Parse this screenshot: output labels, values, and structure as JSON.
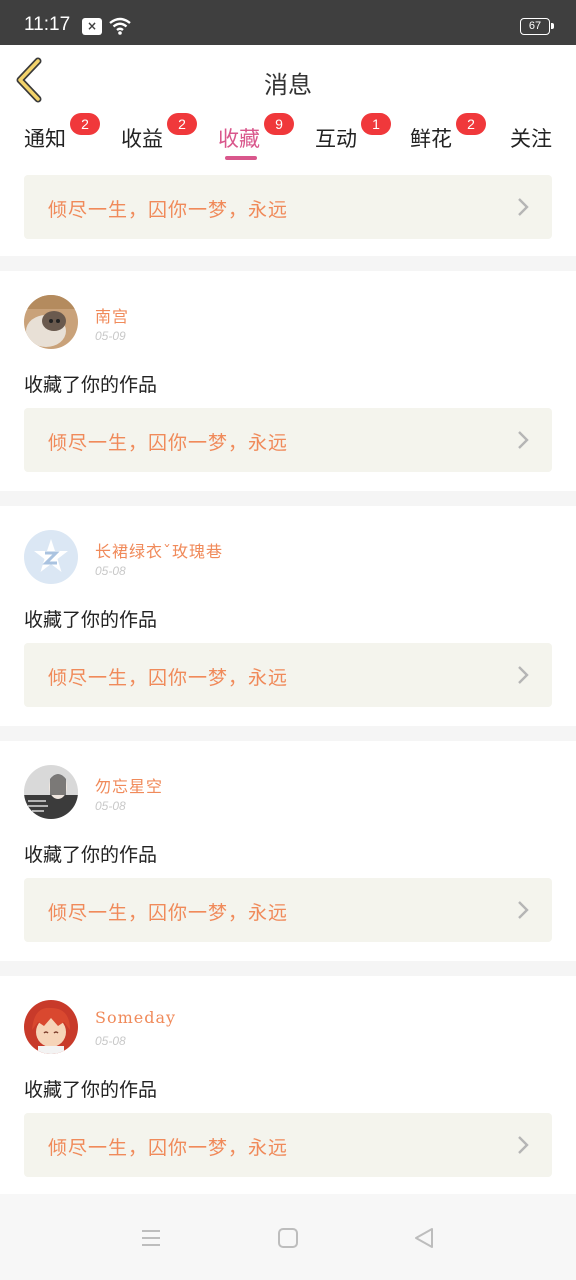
{
  "status_bar": {
    "time": "11:17",
    "battery": "67",
    "icons": [
      "close-notification-icon",
      "wifi-icon",
      "battery-icon"
    ]
  },
  "header": {
    "title": "消息",
    "back_icon": "chevron-left-icon"
  },
  "tabs": [
    {
      "label": "通知",
      "badge": "2",
      "active": false
    },
    {
      "label": "收益",
      "badge": "2",
      "active": false
    },
    {
      "label": "收藏",
      "badge": "9",
      "active": true
    },
    {
      "label": "互动",
      "badge": "1",
      "active": false
    },
    {
      "label": "鲜花",
      "badge": "2",
      "active": false
    },
    {
      "label": "关注",
      "badge": "",
      "active": false
    }
  ],
  "top_banner": {
    "text": "倾尽一生，囚你一梦，永远"
  },
  "messages": [
    {
      "name": "南宫",
      "date": "05-09",
      "action": "收藏了你的作品",
      "work": "倾尽一生，囚你一梦，永远"
    },
    {
      "name": "长裙绿衣ˇ玫瑰巷",
      "date": "05-08",
      "action": "收藏了你的作品",
      "work": "倾尽一生，囚你一梦，永远"
    },
    {
      "name": "勿忘星空",
      "date": "05-08",
      "action": "收藏了你的作品",
      "work": "倾尽一生，囚你一梦，永远"
    },
    {
      "name": "Someday",
      "date": "05-08",
      "action": "收藏了你的作品",
      "work": "倾尽一生，囚你一梦，永远"
    }
  ],
  "colors": {
    "accent": "#d9578c",
    "orange_text": "#f08a5a",
    "badge": "#f0383b",
    "back_arrow": "#f3d36b"
  },
  "nav": {
    "icons": [
      "menu-icon",
      "home-icon",
      "back-triangle-icon"
    ]
  }
}
